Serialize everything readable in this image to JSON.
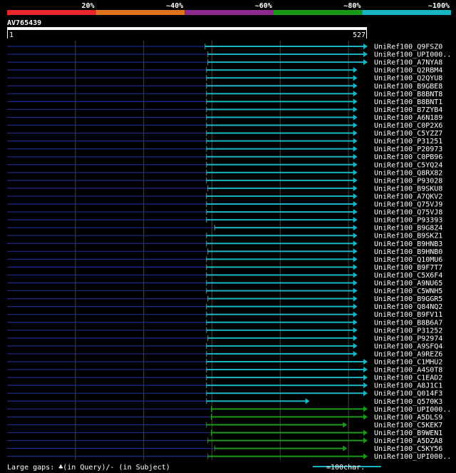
{
  "chart_data": {
    "type": "bar",
    "query": "AV765439",
    "query_start": "1",
    "query_end": "527",
    "query_length": 527,
    "identity_legend": [
      {
        "label": "20%",
        "color": "#e8262c"
      },
      {
        "label": "~40%",
        "color": "#e0741c"
      },
      {
        "label": "~60%",
        "color": "#8e2a8e"
      },
      {
        "label": "~80%",
        "color": "#189a18"
      },
      {
        "label": "~100%",
        "color": "#19b5c4"
      }
    ],
    "footer_left": "Large gaps: ♣(in Query)/- (in Subject)",
    "footer_right": "=100char.",
    "scale_chars": 100,
    "hits": [
      {
        "name": "UniRef100_Q9FSZ0",
        "start": 290,
        "end": 527,
        "color": "#19b5c4"
      },
      {
        "name": "UniRef100_UPI000..",
        "start": 294,
        "end": 527,
        "color": "#19b5c4"
      },
      {
        "name": "UniRef100_A7NYA8",
        "start": 294,
        "end": 527,
        "color": "#19b5c4"
      },
      {
        "name": "UniRef100_Q2RBM4",
        "start": 292,
        "end": 512,
        "color": "#19b5c4"
      },
      {
        "name": "UniRef100_Q2QYU8",
        "start": 292,
        "end": 512,
        "color": "#19b5c4"
      },
      {
        "name": "UniRef100_B9GBE8",
        "start": 292,
        "end": 512,
        "color": "#19b5c4"
      },
      {
        "name": "UniRef100_B8BNT8",
        "start": 292,
        "end": 512,
        "color": "#19b5c4"
      },
      {
        "name": "UniRef100_B8BNT1",
        "start": 292,
        "end": 512,
        "color": "#19b5c4"
      },
      {
        "name": "UniRef100_B7ZYB4",
        "start": 292,
        "end": 512,
        "color": "#19b5c4"
      },
      {
        "name": "UniRef100_A6N189",
        "start": 292,
        "end": 512,
        "color": "#19b5c4"
      },
      {
        "name": "UniRef100_C0P2X6",
        "start": 292,
        "end": 512,
        "color": "#19b5c4"
      },
      {
        "name": "UniRef100_C5YZZ7",
        "start": 292,
        "end": 512,
        "color": "#19b5c4"
      },
      {
        "name": "UniRef100_P31251",
        "start": 292,
        "end": 512,
        "color": "#19b5c4"
      },
      {
        "name": "UniRef100_P20973",
        "start": 292,
        "end": 512,
        "color": "#19b5c4"
      },
      {
        "name": "UniRef100_C0PB96",
        "start": 292,
        "end": 512,
        "color": "#19b5c4"
      },
      {
        "name": "UniRef100_C5YQ24",
        "start": 292,
        "end": 512,
        "color": "#19b5c4"
      },
      {
        "name": "UniRef100_Q8RX82",
        "start": 292,
        "end": 512,
        "color": "#19b5c4"
      },
      {
        "name": "UniRef100_P93028",
        "start": 292,
        "end": 512,
        "color": "#19b5c4"
      },
      {
        "name": "UniRef100_B9SKU8",
        "start": 294,
        "end": 512,
        "color": "#19b5c4"
      },
      {
        "name": "UniRef100_A7QKV2",
        "start": 292,
        "end": 512,
        "color": "#19b5c4"
      },
      {
        "name": "UniRef100_Q75VJ9",
        "start": 292,
        "end": 512,
        "color": "#19b5c4"
      },
      {
        "name": "UniRef100_Q75VJ8",
        "start": 292,
        "end": 512,
        "color": "#19b5c4"
      },
      {
        "name": "UniRef100_P93393",
        "start": 292,
        "end": 512,
        "color": "#19b5c4"
      },
      {
        "name": "UniRef100_B9G8Z4",
        "start": 304,
        "end": 512,
        "color": "#19b5c4"
      },
      {
        "name": "UniRef100_B9SKZ1",
        "start": 292,
        "end": 512,
        "color": "#19b5c4"
      },
      {
        "name": "UniRef100_B9HNB3",
        "start": 292,
        "end": 512,
        "color": "#19b5c4"
      },
      {
        "name": "UniRef100_B9HNB0",
        "start": 294,
        "end": 512,
        "color": "#19b5c4"
      },
      {
        "name": "UniRef100_Q10MU6",
        "start": 292,
        "end": 512,
        "color": "#19b5c4"
      },
      {
        "name": "UniRef100_B9F7T7",
        "start": 292,
        "end": 512,
        "color": "#19b5c4"
      },
      {
        "name": "UniRef100_C5X6F4",
        "start": 292,
        "end": 512,
        "color": "#19b5c4"
      },
      {
        "name": "UniRef100_A9NU65",
        "start": 292,
        "end": 512,
        "color": "#19b5c4"
      },
      {
        "name": "UniRef100_C5WNH5",
        "start": 292,
        "end": 512,
        "color": "#19b5c4"
      },
      {
        "name": "UniRef100_B9GGR5",
        "start": 294,
        "end": 512,
        "color": "#19b5c4"
      },
      {
        "name": "UniRef100_Q84NQ2",
        "start": 292,
        "end": 512,
        "color": "#19b5c4"
      },
      {
        "name": "UniRef100_B9FV11",
        "start": 292,
        "end": 512,
        "color": "#19b5c4"
      },
      {
        "name": "UniRef100_B8B6A7",
        "start": 292,
        "end": 512,
        "color": "#19b5c4"
      },
      {
        "name": "UniRef100_P31252",
        "start": 292,
        "end": 512,
        "color": "#19b5c4"
      },
      {
        "name": "UniRef100_P92974",
        "start": 294,
        "end": 512,
        "color": "#19b5c4"
      },
      {
        "name": "UniRef100_A9SFQ4",
        "start": 292,
        "end": 512,
        "color": "#19b5c4"
      },
      {
        "name": "UniRef100_A9REZ6",
        "start": 292,
        "end": 512,
        "color": "#19b5c4"
      },
      {
        "name": "UniRef100_C1MHU2",
        "start": 292,
        "end": 527,
        "color": "#19b5c4"
      },
      {
        "name": "UniRef100_A4S0T8",
        "start": 292,
        "end": 527,
        "color": "#19b5c4"
      },
      {
        "name": "UniRef100_C1EAD2",
        "start": 292,
        "end": 527,
        "color": "#19b5c4"
      },
      {
        "name": "UniRef100_A8J1C1",
        "start": 292,
        "end": 527,
        "color": "#19b5c4"
      },
      {
        "name": "UniRef100_Q014F3",
        "start": 292,
        "end": 527,
        "color": "#19b5c4"
      },
      {
        "name": "UniRef100_Q570K3",
        "start": 292,
        "end": 442,
        "color": "#19b5c4"
      },
      {
        "name": "UniRef100_UPI000..",
        "start": 299,
        "end": 527,
        "color": "#189a18"
      },
      {
        "name": "UniRef100_A5DLS9",
        "start": 299,
        "end": 527,
        "color": "#189a18"
      },
      {
        "name": "UniRef100_C5KEK7",
        "start": 292,
        "end": 497,
        "color": "#189a18"
      },
      {
        "name": "UniRef100_B9WEN1",
        "start": 299,
        "end": 527,
        "color": "#189a18"
      },
      {
        "name": "UniRef100_A5DZA8",
        "start": 294,
        "end": 527,
        "color": "#189a18"
      },
      {
        "name": "UniRef100_C5KY56",
        "start": 304,
        "end": 497,
        "color": "#189a18"
      },
      {
        "name": "UniRef100_UPI000..",
        "start": 294,
        "end": 527,
        "color": "#189a18"
      }
    ]
  }
}
